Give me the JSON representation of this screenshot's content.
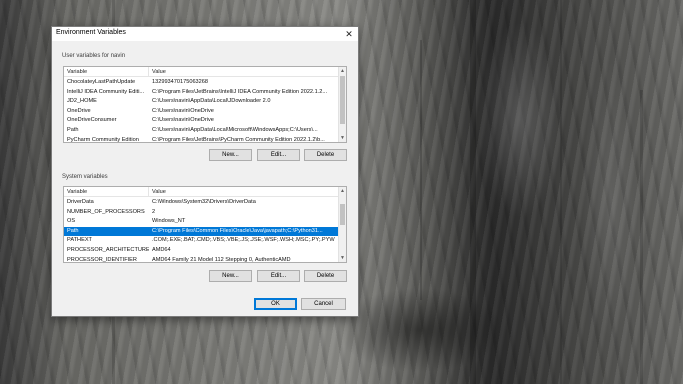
{
  "dialog": {
    "title": "Environment Variables",
    "close_icon": "close-icon"
  },
  "user_vars": {
    "group_label": "User variables for navin",
    "columns": [
      "Variable",
      "Value"
    ],
    "rows": [
      {
        "variable": "ChocolateyLastPathUpdate",
        "value": "132993470175063268"
      },
      {
        "variable": "IntelliJ IDEA Community Editi...",
        "value": "C:\\Program Files\\JetBrains\\IntelliJ IDEA Community Edition 2022.1.2..."
      },
      {
        "variable": "JD2_HOME",
        "value": "C:\\Users\\navin\\AppData\\Local\\JDownloader 2.0"
      },
      {
        "variable": "OneDrive",
        "value": "C:\\Users\\navin\\OneDrive"
      },
      {
        "variable": "OneDriveConsumer",
        "value": "C:\\Users\\navin\\OneDrive"
      },
      {
        "variable": "Path",
        "value": "C:\\Users\\navin\\AppData\\Local\\Microsoft\\WindowsApps;C:\\Users\\..."
      },
      {
        "variable": "PyCharm Community Edition",
        "value": "C:\\Program Files\\JetBrains\\PyCharm Community Edition 2022.1.2\\b..."
      }
    ],
    "buttons": {
      "new": "New...",
      "edit": "Edit...",
      "delete": "Delete"
    }
  },
  "system_vars": {
    "group_label": "System variables",
    "columns": [
      "Variable",
      "Value"
    ],
    "rows": [
      {
        "variable": "DriverData",
        "value": "C:\\Windows\\System32\\Drivers\\DriverData"
      },
      {
        "variable": "NUMBER_OF_PROCESSORS",
        "value": "2"
      },
      {
        "variable": "OS",
        "value": "Windows_NT"
      },
      {
        "variable": "Path",
        "value": "C:\\Program Files\\Common Files\\Oracle\\Java\\javapath;C:\\Python31...",
        "selected": true
      },
      {
        "variable": "PATHEXT",
        "value": ".COM;.EXE;.BAT;.CMD;.VBS;.VBE;.JS;.JSE;.WSF;.WSH;.MSC;.PY;.PYW"
      },
      {
        "variable": "PROCESSOR_ARCHITECTURE",
        "value": "AMD64"
      },
      {
        "variable": "PROCESSOR_IDENTIFIER",
        "value": "AMD64 Family 21 Model 112 Stepping 0, AuthenticAMD"
      }
    ],
    "buttons": {
      "new": "New...",
      "edit": "Edit...",
      "delete": "Delete"
    }
  },
  "footer": {
    "ok": "OK",
    "cancel": "Cancel"
  },
  "colors": {
    "selection": "#0078d7",
    "dialog_bg": "#f0f0f0"
  }
}
